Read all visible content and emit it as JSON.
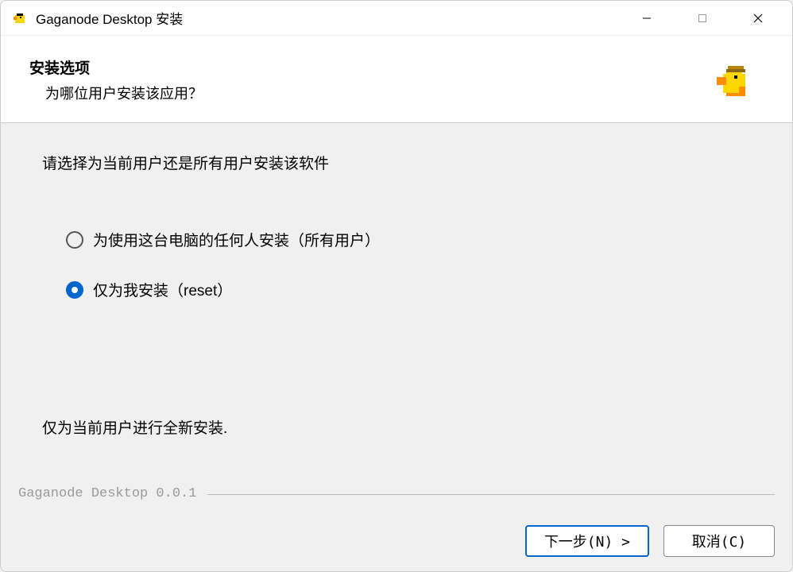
{
  "titlebar": {
    "title": "Gaganode Desktop 安装",
    "icon": "duck-icon"
  },
  "header": {
    "title": "安装选项",
    "subtitle": "为哪位用户安装该应用？",
    "logo": "duck-icon"
  },
  "main": {
    "instruction": "请选择为当前用户还是所有用户安装该软件",
    "options": [
      {
        "label": "为使用这台电脑的任何人安装（所有用户）",
        "selected": false
      },
      {
        "label": "仅为我安装（reset）",
        "selected": true
      }
    ],
    "description": "仅为当前用户进行全新安装.",
    "version": "Gaganode Desktop 0.0.1"
  },
  "footer": {
    "next_label": "下一步(N) >",
    "cancel_label": "取消(C)"
  }
}
